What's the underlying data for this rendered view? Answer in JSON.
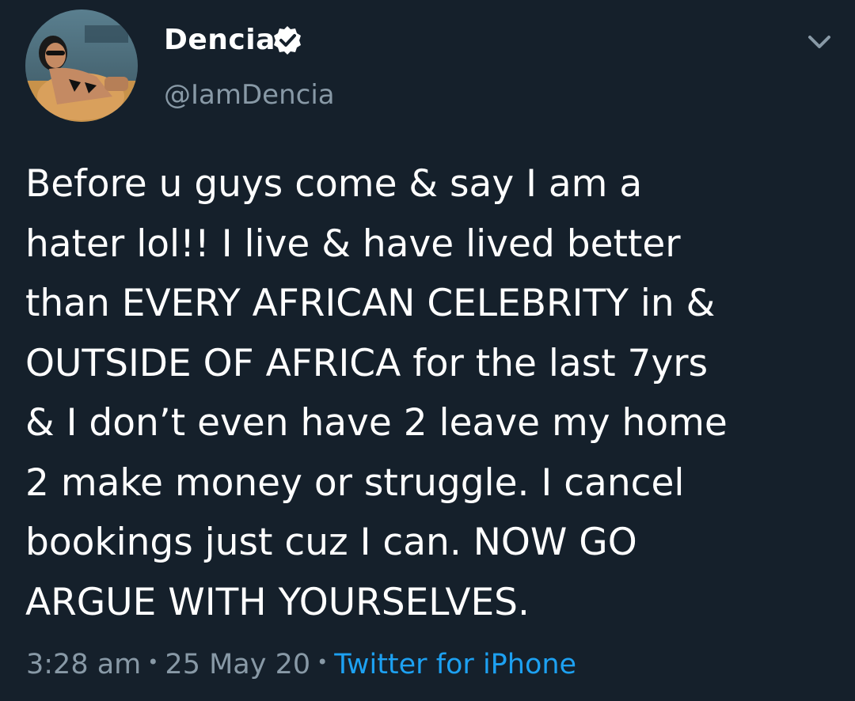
{
  "profile": {
    "display_name": "Dencia",
    "handle": "@IamDencia",
    "verified": true
  },
  "tweet": {
    "lines": [
      "Before u guys come & say I am a",
      "hater lol!! I live & have lived better",
      "than EVERY AFRICAN CELEBRITY in &",
      "OUTSIDE OF AFRICA for the last 7yrs",
      "& I don’t even have 2 leave my home",
      "2 make money or struggle. I cancel",
      "bookings just cuz I can. NOW GO",
      "ARGUE WITH YOURSELVES."
    ]
  },
  "meta": {
    "time": "3:28 am",
    "date": "25 May 20",
    "separator": "•",
    "source": "Twitter for iPhone"
  },
  "icons": {
    "verified": "verified-badge-icon",
    "menu": "chevron-down-icon"
  },
  "colors": {
    "background": "#15202b",
    "text": "#ffffff",
    "secondary": "#8899a6",
    "link": "#1da1f2"
  }
}
